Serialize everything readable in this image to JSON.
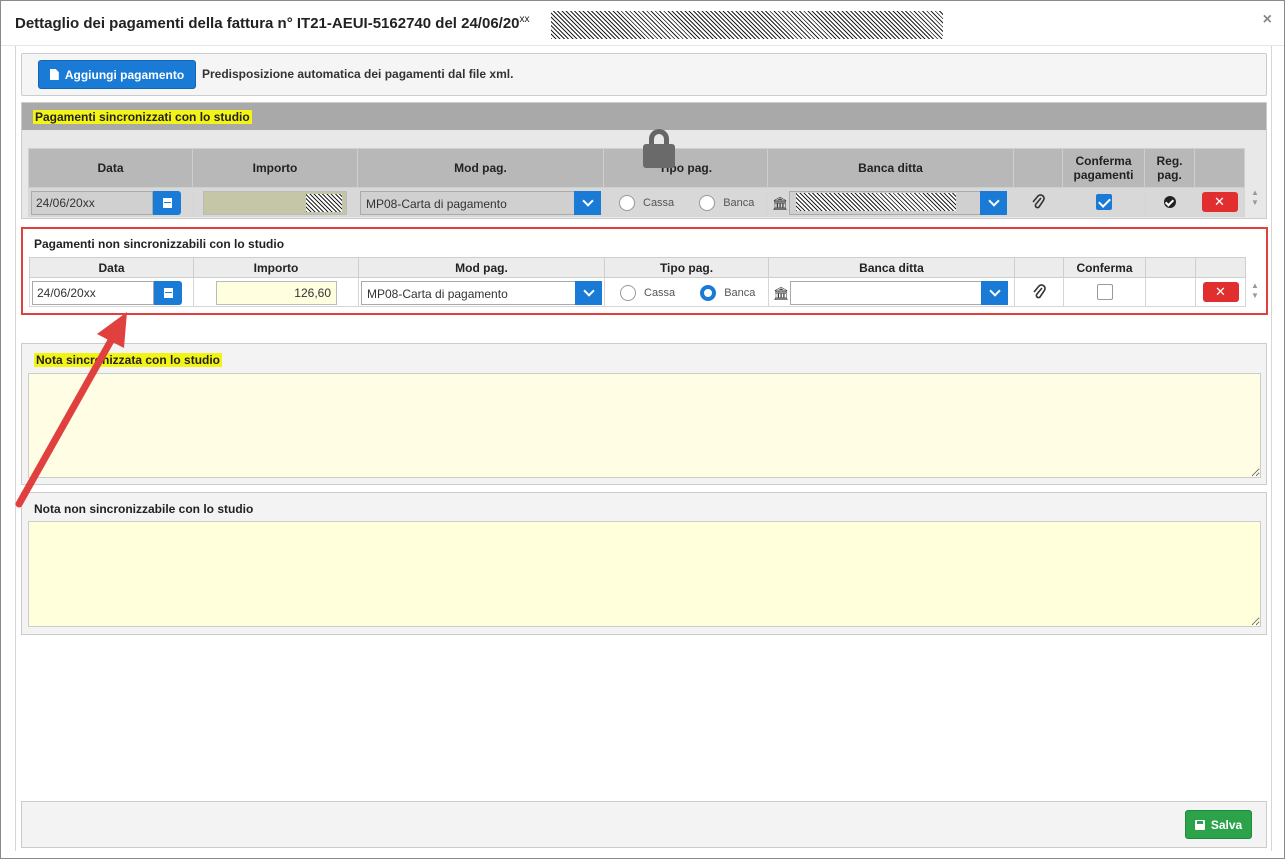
{
  "dialog": {
    "title": "Dettaglio dei pagamenti della fattura n° IT21-AEUI-5162740 del 24/06/20",
    "title_suffix": "xx",
    "close": "×"
  },
  "toolbar": {
    "add_payment_label": "Aggiungi pagamento",
    "description": "Predisposizione automatica dei pagamenti dal file xml."
  },
  "synced": {
    "title": "Pagamenti sincronizzati con lo studio",
    "headers": {
      "data": "Data",
      "importo": "Importo",
      "mod_pag": "Mod pag.",
      "tipo_pag": "Tipo pag.",
      "banca": "Banca ditta",
      "conferma": "Conferma pagamenti",
      "reg": "Reg. pag."
    },
    "row": {
      "date": "24/06/20",
      "date_suffix": "xx",
      "mod_pag": "MP08-Carta di pagamento",
      "cassa": "Cassa",
      "banca": "Banca",
      "confirmed": true,
      "registered": true
    }
  },
  "not_synced": {
    "title": "Pagamenti non sincronizzabili con lo studio",
    "headers": {
      "data": "Data",
      "importo": "Importo",
      "mod_pag": "Mod pag.",
      "tipo_pag": "Tipo pag.",
      "banca": "Banca ditta",
      "conferma": "Conferma"
    },
    "row": {
      "date": "24/06/20",
      "date_suffix": "xx",
      "amount": "126,60",
      "mod_pag": "MP08-Carta di pagamento",
      "cassa": "Cassa",
      "banca": "Banca",
      "selected_tipo": "Banca",
      "confirmed": false
    }
  },
  "notes": {
    "synced_label": "Nota sincronizzata con lo studio",
    "not_synced_label": "Nota non sincronizzabile con lo studio"
  },
  "footer": {
    "save_label": "Salva"
  },
  "colors": {
    "primary": "#1a7bd6",
    "danger": "#e12f2f",
    "success": "#2ca24a",
    "highlight": "#f3f315",
    "annotation": "#e0413f"
  },
  "icons": [
    "file-icon",
    "calendar-icon",
    "chevron-down-icon",
    "bank-icon",
    "paperclip-icon",
    "check-circle-icon",
    "close-icon",
    "lock-icon",
    "save-icon"
  ]
}
